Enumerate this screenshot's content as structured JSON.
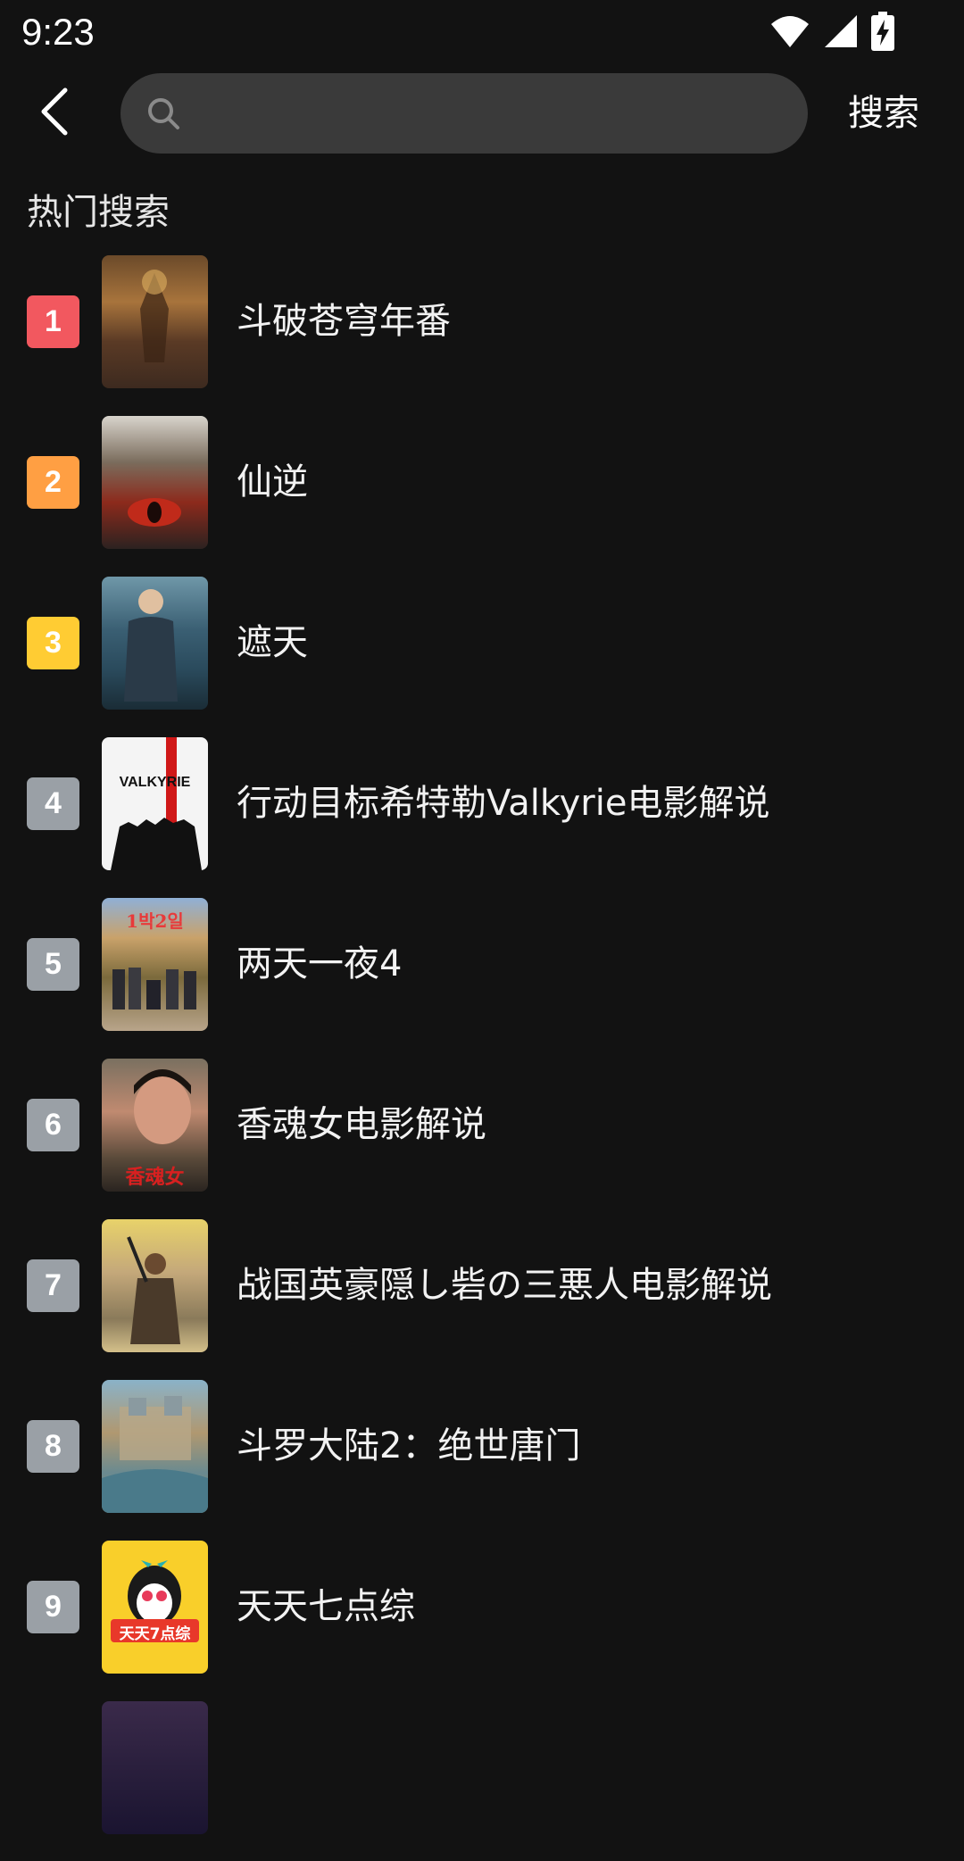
{
  "status_bar": {
    "time": "9:23",
    "icons": [
      "wifi-icon",
      "signal-icon",
      "battery-charging-icon"
    ]
  },
  "header": {
    "back_icon": "chevron-left-icon",
    "search_placeholder": "",
    "search_value": "",
    "search_button_label": "搜索"
  },
  "hot_search": {
    "title": "热门搜索",
    "items": [
      {
        "rank": "1",
        "title": "斗破苍穹年番",
        "badge_color": "#f2585f"
      },
      {
        "rank": "2",
        "title": "仙逆",
        "badge_color": "#ff9f43"
      },
      {
        "rank": "3",
        "title": "遮天",
        "badge_color": "#ffcc33"
      },
      {
        "rank": "4",
        "title": "行动目标希特勒Valkyrie电影解说",
        "badge_color": "#9aa0a6",
        "poster_text": "VALKYRIE"
      },
      {
        "rank": "5",
        "title": "两天一夜4",
        "badge_color": "#9aa0a6",
        "poster_text": "1박2일"
      },
      {
        "rank": "6",
        "title": "香魂女电影解说",
        "badge_color": "#9aa0a6",
        "poster_text": "香魂女"
      },
      {
        "rank": "7",
        "title": "战国英豪隠し砦の三悪人电影解说",
        "badge_color": "#9aa0a6"
      },
      {
        "rank": "8",
        "title": "斗罗大陆2：绝世唐门",
        "badge_color": "#9aa0a6"
      },
      {
        "rank": "9",
        "title": "天天七点综",
        "badge_color": "#9aa0a6",
        "poster_text": "天天7点综"
      }
    ]
  }
}
